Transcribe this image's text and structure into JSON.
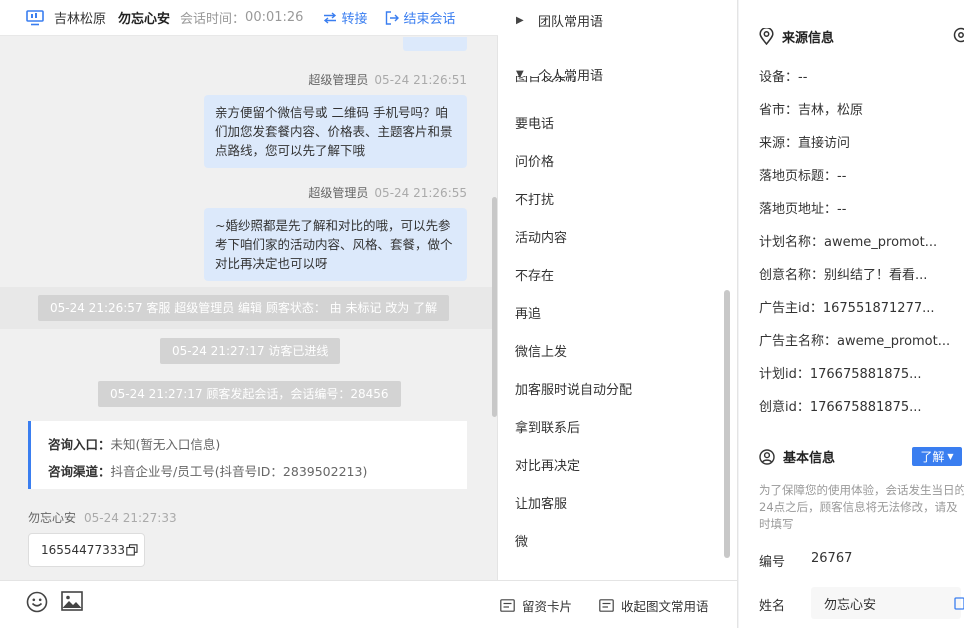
{
  "header": {
    "location": "吉林松原",
    "nickname": "勿忘心安",
    "session_time_label": "会话时间：",
    "session_time": "00:01:26",
    "transfer_label": "转接",
    "end_label": "结束会话"
  },
  "messages": [
    {
      "sender": "超级管理员",
      "time": "05-24 21:26:51",
      "text": "亲方便留个微信号或 二维码 手机号吗？咱们加您发套餐内容、价格表、主题客片和景点路线，您可以先了解下哦"
    },
    {
      "sender": "超级管理员",
      "time": "05-24 21:26:55",
      "text": "~婚纱照都是先了解和对比的哦，可以先参考下咱们家的活动内容、风格、套餐，做个对比再决定也可以呀"
    }
  ],
  "system_notices": [
    "05-24 21:26:57 客服 超级管理员 编辑 顾客状态： 由 未标记 改为 了解",
    "05-24 21:27:17 访客已进线",
    "05-24 21:27:17 顾客发起会话，会话编号：28456"
  ],
  "consult": {
    "entry_label": "咨询入口：",
    "entry_value": "未知(暂无入口信息)",
    "channel_label": "咨询渠道：",
    "channel_value": "抖音企业号/员工号(抖音号ID：2839502213)"
  },
  "visitor": {
    "name": "勿忘心安",
    "time": "05-24 21:27:33",
    "message": "16554477333"
  },
  "phrases": {
    "team_group": "团队常用语",
    "personal_group": "个人常用语",
    "cut_item": "图百发条厅",
    "items": [
      "要电话",
      "问价格",
      "不打扰",
      "活动内容",
      "不存在",
      "再追",
      "微信上发",
      "加客服时说自动分配",
      "拿到联系后",
      "对比再决定",
      "让加客服",
      "微"
    ],
    "footer_card": "留资卡片",
    "footer_collapse": "收起图文常用语"
  },
  "source_info": {
    "title": "来源信息",
    "fields": [
      "设备：--",
      "省市：吉林，松原",
      "来源：直接访问",
      "落地页标题：--",
      "落地页地址：--",
      "计划名称：aweme_promot...",
      "创意名称：别纠结了！看看...",
      "广告主id：167551871277...",
      "广告主名称：aweme_promot...",
      "计划id：176675881875...",
      "创意id：176675881875..."
    ]
  },
  "basic_info": {
    "title": "基本信息",
    "status_button": "了解",
    "note": "为了保障您的使用体验，会话发生当日的24点之后，顾客信息将无法修改，请及时填写",
    "id_label": "编号",
    "id_value": "26767",
    "name_label": "姓名",
    "name_value": "勿忘心安"
  },
  "colors": {
    "accent": "#3a7ef0",
    "bubble": "#dce9fb",
    "system_notice": "#d3d3d3"
  }
}
